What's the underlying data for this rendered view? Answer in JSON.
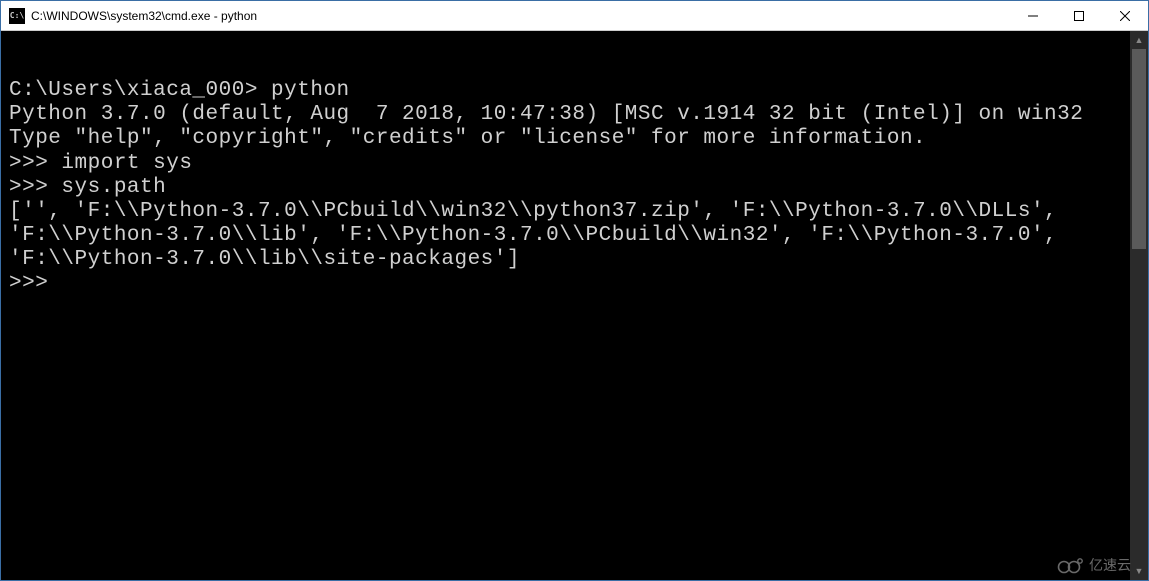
{
  "window": {
    "icon_text": "C:\\",
    "title": "C:\\WINDOWS\\system32\\cmd.exe - python"
  },
  "terminal": {
    "lines": [
      "",
      "C:\\Users\\xiaca_000> python",
      "Python 3.7.0 (default, Aug  7 2018, 10:47:38) [MSC v.1914 32 bit (Intel)] on win32",
      "Type \"help\", \"copyright\", \"credits\" or \"license\" for more information.",
      ">>> import sys",
      ">>> sys.path",
      "['', 'F:\\\\Python-3.7.0\\\\PCbuild\\\\win32\\\\python37.zip', 'F:\\\\Python-3.7.0\\\\DLLs', 'F:\\\\Python-3.7.0\\\\lib', 'F:\\\\Python-3.7.0\\\\PCbuild\\\\win32', 'F:\\\\Python-3.7.0', 'F:\\\\Python-3.7.0\\\\lib\\\\site-packages']",
      ">>>"
    ]
  },
  "watermark": {
    "text": "亿速云"
  }
}
